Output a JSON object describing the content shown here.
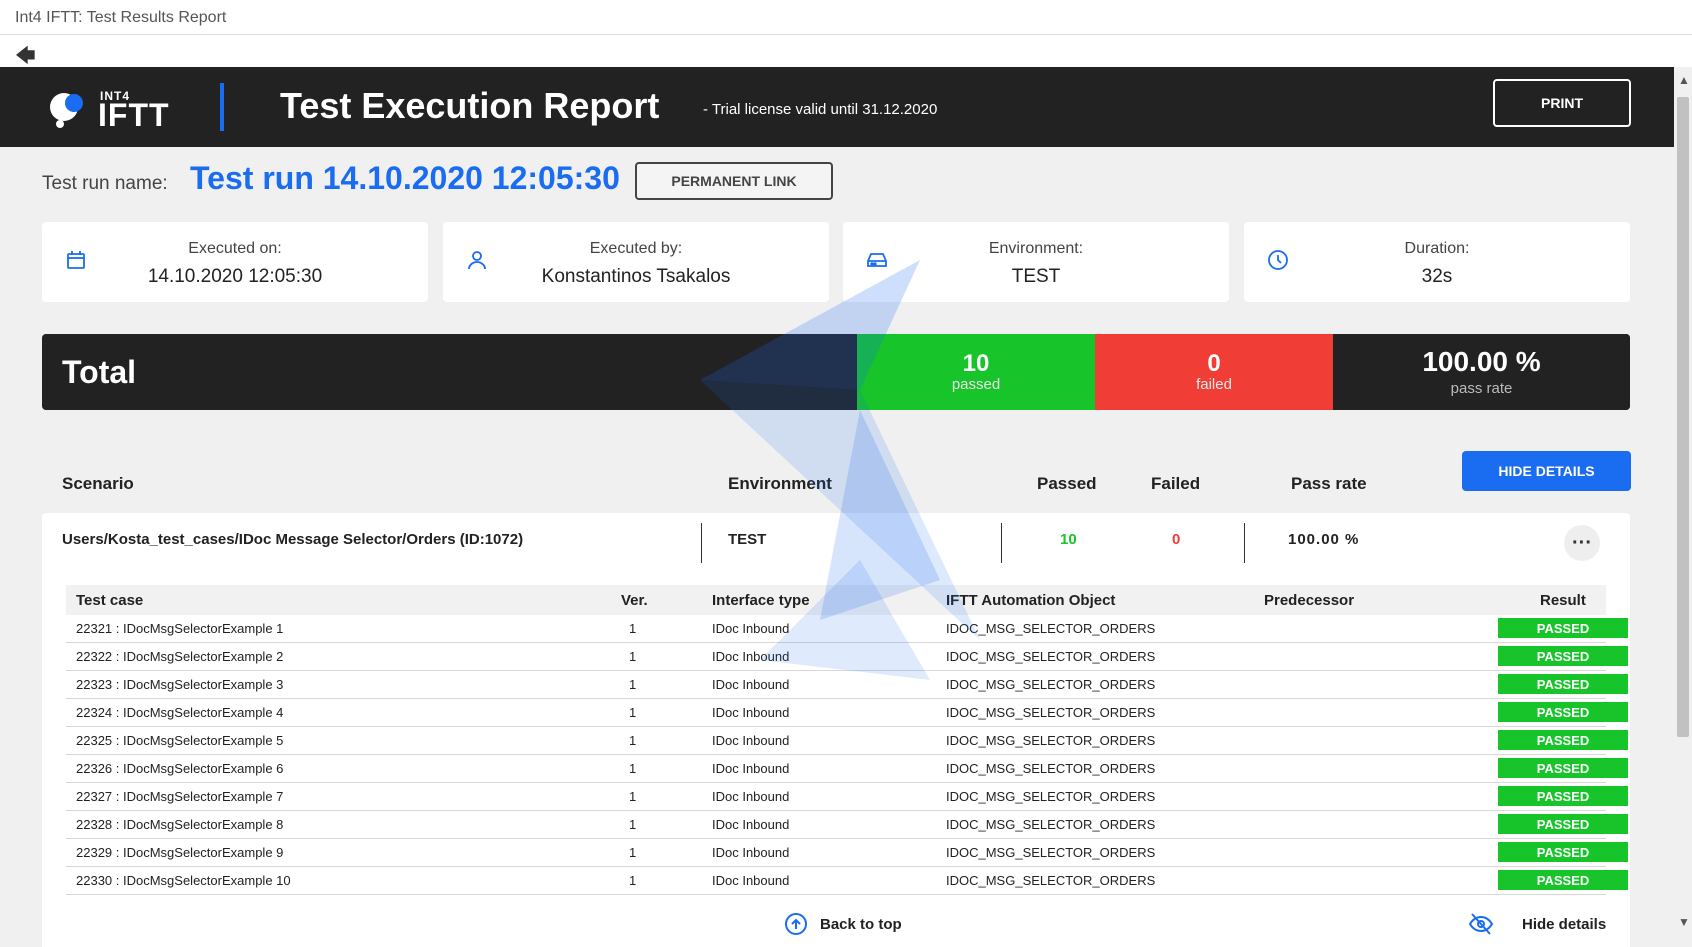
{
  "window": {
    "title": "Int4 IFTT: Test Results Report"
  },
  "header": {
    "logo_small": "INT4",
    "logo_big": "IFTT",
    "title": "Test Execution Report",
    "trial": "- Trial license valid until 31.12.2020",
    "print_label": "PRINT"
  },
  "run": {
    "label": "Test run name:",
    "name": "Test run 14.10.2020 12:05:30",
    "permanent_link_label": "PERMANENT LINK"
  },
  "cards": [
    {
      "label": "Executed on:",
      "value": "14.10.2020 12:05:30",
      "icon": "calendar-icon"
    },
    {
      "label": "Executed by:",
      "value": "Konstantinos Tsakalos",
      "icon": "user-icon"
    },
    {
      "label": "Environment:",
      "value": "TEST",
      "icon": "server-icon"
    },
    {
      "label": "Duration:",
      "value": "32s",
      "icon": "clock-icon"
    }
  ],
  "total": {
    "label": "Total",
    "passed": "10",
    "passed_label": "passed",
    "failed": "0",
    "failed_label": "failed",
    "rate": "100.00 %",
    "rate_label": "pass rate"
  },
  "columns": {
    "scenario": "Scenario",
    "environment": "Environment",
    "passed": "Passed",
    "failed": "Failed",
    "pass_rate": "Pass rate",
    "hide_details": "HIDE DETAILS"
  },
  "scenario": {
    "name": "Users/Kosta_test_cases/IDoc Message Selector/Orders (ID:1072)",
    "environment": "TEST",
    "passed": "10",
    "failed": "0",
    "rate": "100.00 %",
    "more": "···"
  },
  "table": {
    "headers": {
      "test_case": "Test case",
      "ver": "Ver.",
      "interface": "Interface type",
      "object": "IFTT Automation Object",
      "predecessor": "Predecessor",
      "result": "Result"
    },
    "rows": [
      {
        "case": "22321 : IDocMsgSelectorExample 1",
        "ver": "1",
        "interface": "IDoc Inbound",
        "object": "IDOC_MSG_SELECTOR_ORDERS",
        "predecessor": "",
        "result": "PASSED"
      },
      {
        "case": "22322 : IDocMsgSelectorExample 2",
        "ver": "1",
        "interface": "IDoc Inbound",
        "object": "IDOC_MSG_SELECTOR_ORDERS",
        "predecessor": "",
        "result": "PASSED"
      },
      {
        "case": "22323 : IDocMsgSelectorExample 3",
        "ver": "1",
        "interface": "IDoc Inbound",
        "object": "IDOC_MSG_SELECTOR_ORDERS",
        "predecessor": "",
        "result": "PASSED"
      },
      {
        "case": "22324 : IDocMsgSelectorExample 4",
        "ver": "1",
        "interface": "IDoc Inbound",
        "object": "IDOC_MSG_SELECTOR_ORDERS",
        "predecessor": "",
        "result": "PASSED"
      },
      {
        "case": "22325 : IDocMsgSelectorExample 5",
        "ver": "1",
        "interface": "IDoc Inbound",
        "object": "IDOC_MSG_SELECTOR_ORDERS",
        "predecessor": "",
        "result": "PASSED"
      },
      {
        "case": "22326 : IDocMsgSelectorExample 6",
        "ver": "1",
        "interface": "IDoc Inbound",
        "object": "IDOC_MSG_SELECTOR_ORDERS",
        "predecessor": "",
        "result": "PASSED"
      },
      {
        "case": "22327 : IDocMsgSelectorExample 7",
        "ver": "1",
        "interface": "IDoc Inbound",
        "object": "IDOC_MSG_SELECTOR_ORDERS",
        "predecessor": "",
        "result": "PASSED"
      },
      {
        "case": "22328 : IDocMsgSelectorExample 8",
        "ver": "1",
        "interface": "IDoc Inbound",
        "object": "IDOC_MSG_SELECTOR_ORDERS",
        "predecessor": "",
        "result": "PASSED"
      },
      {
        "case": "22329 : IDocMsgSelectorExample 9",
        "ver": "1",
        "interface": "IDoc Inbound",
        "object": "IDOC_MSG_SELECTOR_ORDERS",
        "predecessor": "",
        "result": "PASSED"
      },
      {
        "case": "22330 : IDocMsgSelectorExample 10",
        "ver": "1",
        "interface": "IDoc Inbound",
        "object": "IDOC_MSG_SELECTOR_ORDERS",
        "predecessor": "",
        "result": "PASSED"
      }
    ]
  },
  "footer": {
    "back_to_top": "Back to top",
    "hide_details": "Hide details"
  },
  "colors": {
    "accent": "#1a6cf0",
    "passed": "#17c42a",
    "failed": "#f03d36",
    "dark": "#222222"
  },
  "icons": {
    "back": "arrow-left-icon",
    "back_to_top": "arrow-up-circle-icon",
    "hide": "eye-off-icon"
  }
}
